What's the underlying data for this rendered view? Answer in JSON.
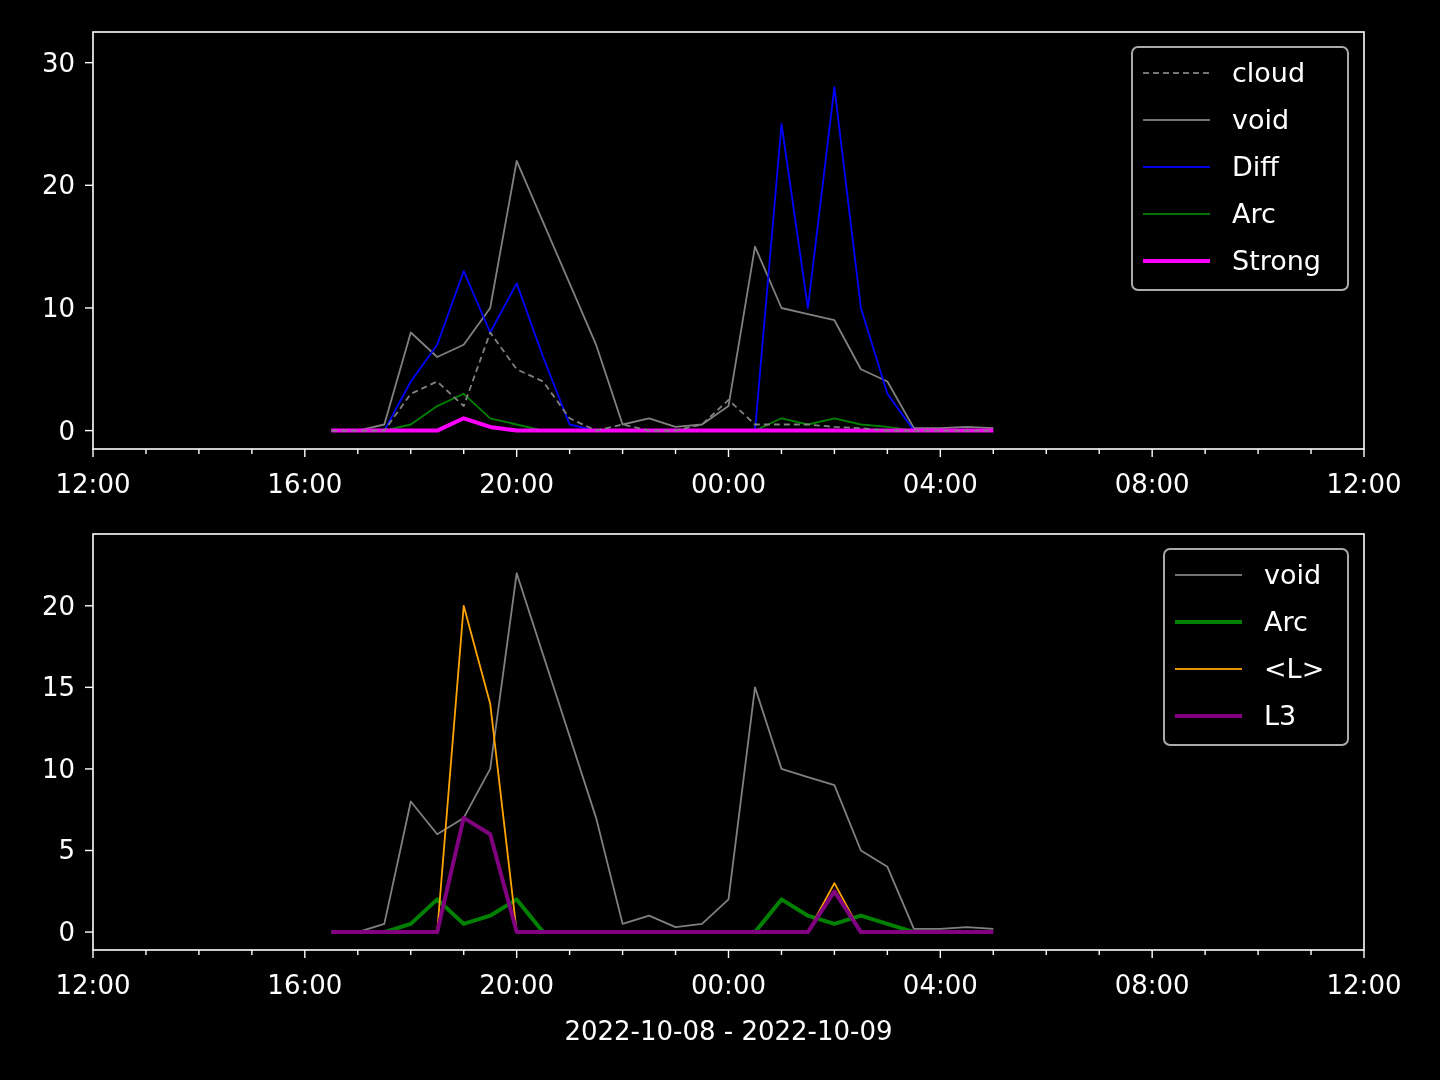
{
  "charts": [
    {
      "line_thick": [
        false,
        false,
        false,
        false,
        true
      ],
      "chart_data": {
        "type": "line",
        "legend": true,
        "categories": [
          "12:00",
          null,
          null,
          null,
          null,
          null,
          null,
          null,
          "16:00",
          null,
          null,
          null,
          null,
          null,
          null,
          null,
          "20:00",
          null,
          null,
          null,
          null,
          null,
          null,
          null,
          "00:00",
          null,
          null,
          null,
          null,
          null,
          null,
          null,
          "04:00",
          null,
          null,
          null,
          null,
          null,
          null,
          null,
          "08:00",
          null,
          null,
          null,
          null,
          null,
          null,
          null,
          "12:00"
        ],
        "ylim": [
          -1.5,
          32.5
        ],
        "yticks": [
          0,
          10,
          20,
          30
        ],
        "series": [
          {
            "name": "cloud",
            "color": "#808080",
            "line_style": "dashed",
            "values": [
              null,
              null,
              null,
              null,
              null,
              null,
              null,
              null,
              null,
              0,
              0,
              0,
              3,
              4,
              2,
              8,
              5,
              4,
              1,
              0,
              0.5,
              0,
              0,
              0.5,
              2.5,
              0.5,
              0.5,
              0.5,
              0.3,
              0.2,
              0,
              0,
              0,
              0,
              0,
              null,
              null,
              null,
              null,
              null,
              null,
              null,
              null,
              null,
              null,
              null,
              null,
              null,
              null
            ]
          },
          {
            "name": "void",
            "color": "#808080",
            "line_style": "solid",
            "values": [
              null,
              null,
              null,
              null,
              null,
              null,
              null,
              null,
              null,
              0,
              0,
              0.5,
              8,
              6,
              7,
              10,
              22,
              17,
              12,
              7,
              0.5,
              1,
              0.3,
              0.5,
              2,
              15,
              10,
              9.5,
              9,
              5,
              4,
              0.2,
              0.2,
              0.3,
              0.2,
              null,
              null,
              null,
              null,
              null,
              null,
              null,
              null,
              null,
              null,
              null,
              null,
              null,
              null
            ]
          },
          {
            "name": "Diff",
            "color": "#0000ff",
            "line_style": "solid",
            "values": [
              null,
              null,
              null,
              null,
              null,
              null,
              null,
              null,
              null,
              0,
              0,
              0,
              4,
              7,
              13,
              8,
              12,
              6,
              0.5,
              0,
              0,
              0,
              0,
              0,
              0,
              0,
              25,
              10,
              28,
              10,
              3,
              0,
              0,
              null,
              null,
              null,
              null,
              null,
              null,
              null,
              null,
              null,
              null,
              null,
              null,
              null,
              null,
              null,
              null
            ]
          },
          {
            "name": "Arc",
            "color": "#008000",
            "line_style": "solid",
            "values": [
              null,
              null,
              null,
              null,
              null,
              null,
              null,
              null,
              null,
              0,
              0,
              0,
              0.5,
              2,
              3,
              1,
              0.5,
              0,
              0,
              0,
              0,
              0,
              0,
              0,
              0,
              0,
              1,
              0.5,
              1,
              0.5,
              0.3,
              0,
              0,
              null,
              null,
              null,
              null,
              null,
              null,
              null,
              null,
              null,
              null,
              null,
              null,
              null,
              null,
              null,
              null
            ]
          },
          {
            "name": "Strong",
            "color": "#ff00ff",
            "line_style": "solid",
            "values": [
              null,
              null,
              null,
              null,
              null,
              null,
              null,
              null,
              null,
              0,
              0,
              0,
              0,
              0,
              1,
              0.3,
              0,
              0,
              0,
              0,
              0,
              0,
              0,
              0,
              0,
              0,
              0,
              0,
              0,
              0,
              0,
              0,
              0,
              0,
              0,
              null,
              null,
              null,
              null,
              null,
              null,
              null,
              null,
              null,
              null,
              null,
              null,
              null,
              null
            ]
          }
        ]
      }
    },
    {
      "line_thick": [
        false,
        true,
        false,
        true
      ],
      "chart_data": {
        "type": "line",
        "legend": true,
        "xlabel": "2022-10-08 - 2022-10-09",
        "categories": [
          "12:00",
          null,
          null,
          null,
          null,
          null,
          null,
          null,
          "16:00",
          null,
          null,
          null,
          null,
          null,
          null,
          null,
          "20:00",
          null,
          null,
          null,
          null,
          null,
          null,
          null,
          "00:00",
          null,
          null,
          null,
          null,
          null,
          null,
          null,
          "04:00",
          null,
          null,
          null,
          null,
          null,
          null,
          null,
          "08:00",
          null,
          null,
          null,
          null,
          null,
          null,
          null,
          "12:00"
        ],
        "ylim": [
          -1.1,
          24.4
        ],
        "yticks": [
          0,
          5,
          10,
          15,
          20
        ],
        "series": [
          {
            "name": "void",
            "color": "#808080",
            "line_style": "solid",
            "values": [
              null,
              null,
              null,
              null,
              null,
              null,
              null,
              null,
              null,
              0,
              0,
              0.5,
              8,
              6,
              7,
              10,
              22,
              17,
              12,
              7,
              0.5,
              1,
              0.3,
              0.5,
              2,
              15,
              10,
              9.5,
              9,
              5,
              4,
              0.2,
              0.2,
              0.3,
              0.2,
              null,
              null,
              null,
              null,
              null,
              null,
              null,
              null,
              null,
              null,
              null,
              null,
              null,
              null
            ]
          },
          {
            "name": "Arc",
            "color": "#008000",
            "line_style": "solid",
            "values": [
              null,
              null,
              null,
              null,
              null,
              null,
              null,
              null,
              null,
              0,
              0,
              0,
              0.5,
              2,
              0.5,
              1,
              2,
              0,
              0,
              0,
              0,
              0,
              0,
              0,
              0,
              0,
              2,
              1,
              0.5,
              1,
              0.5,
              0,
              0,
              null,
              null,
              null,
              null,
              null,
              null,
              null,
              null,
              null,
              null,
              null,
              null,
              null,
              null,
              null,
              null
            ]
          },
          {
            "name": "<L>",
            "color": "#ffa500",
            "line_style": "solid",
            "values": [
              null,
              null,
              null,
              null,
              null,
              null,
              null,
              null,
              null,
              null,
              null,
              null,
              null,
              0,
              20,
              14,
              0,
              null,
              null,
              null,
              null,
              null,
              null,
              null,
              null,
              null,
              null,
              0,
              3,
              0,
              null,
              null,
              null,
              null,
              null,
              null,
              null,
              null,
              null,
              null,
              null,
              null,
              null,
              null,
              null,
              null,
              null,
              null,
              null
            ]
          },
          {
            "name": "L3",
            "color": "#800080",
            "line_style": "solid",
            "values": [
              null,
              null,
              null,
              null,
              null,
              null,
              null,
              null,
              null,
              0,
              0,
              0,
              0,
              0,
              7,
              6,
              0,
              0,
              0,
              0,
              0,
              0,
              0,
              0,
              0,
              0,
              0,
              0,
              2.5,
              0,
              0,
              0,
              0,
              0,
              0,
              null,
              null,
              null,
              null,
              null,
              null,
              null,
              null,
              null,
              null,
              null,
              null,
              null,
              null
            ]
          }
        ]
      }
    }
  ]
}
